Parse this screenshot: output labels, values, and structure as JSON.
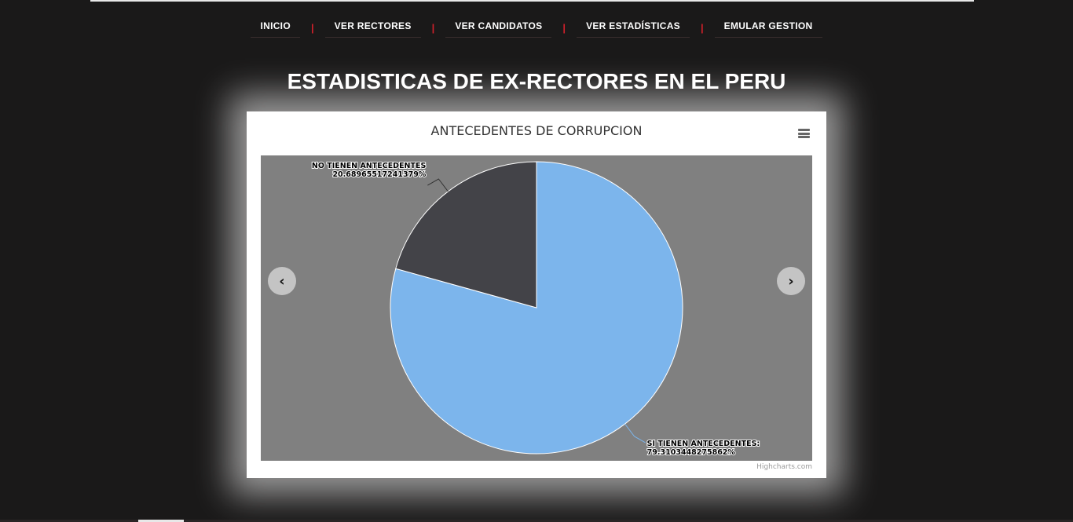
{
  "nav": {
    "items": [
      "INICIO",
      "VER RECTORES",
      "VER CANDIDATOS",
      "VER ESTADÍSTICAS",
      "EMULAR GESTION"
    ],
    "separator": "|"
  },
  "page": {
    "title": "ESTADISTICAS DE EX-RECTORES EN EL PERU"
  },
  "carousel": {
    "prev_glyph": "‹",
    "next_glyph": "›"
  },
  "chart_data": {
    "type": "pie",
    "title": "ANTECEDENTES DE CORRUPCION",
    "credits": "Highcharts.com",
    "slices": [
      {
        "name": "SI TIENEN ANTECEDENTES",
        "value": 79.3103448275862,
        "label_lines": [
          "SI TIENEN ANTECEDENTES:",
          "79.3103448275862%"
        ],
        "color": "#7cb5ec"
      },
      {
        "name": "NO TIENEN ANTECEDENTES",
        "value": 20.68965517241379,
        "label_lines": [
          "NO TIENEN ANTECEDENTES",
          "20.68965517241379%"
        ],
        "color": "#434348"
      }
    ],
    "start": "top-clockwise",
    "background": "#808080",
    "slice_border": "#ffffff"
  }
}
